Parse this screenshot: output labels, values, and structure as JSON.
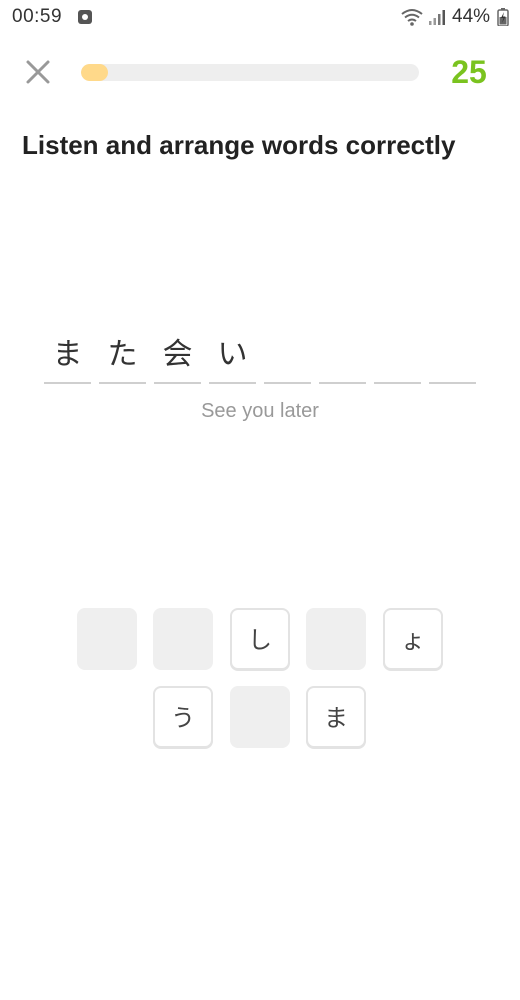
{
  "status_bar": {
    "time": "00:59",
    "battery_percent": "44%"
  },
  "header": {
    "score": "25",
    "progress": 0.08,
    "colors": {
      "progress_fill": "#ffd98a",
      "progress_track": "#eeeeee",
      "score": "#7ac31f"
    }
  },
  "exercise": {
    "instruction": "Listen and arrange words correctly",
    "translation": "See you later",
    "slots": [
      "ま",
      "た",
      "会",
      "い",
      "",
      "",
      "",
      ""
    ],
    "tiles_row1": [
      {
        "char": "",
        "state": "used"
      },
      {
        "char": "",
        "state": "used"
      },
      {
        "char": "し",
        "state": "available"
      },
      {
        "char": "",
        "state": "used"
      },
      {
        "char": "ょ",
        "state": "available"
      }
    ],
    "tiles_row2": [
      {
        "char": "う",
        "state": "available"
      },
      {
        "char": "",
        "state": "used"
      },
      {
        "char": "ま",
        "state": "available"
      }
    ]
  },
  "icons": {
    "close": "close-icon",
    "wifi": "wifi-icon",
    "signal": "signal-icon",
    "battery": "battery-charging-icon",
    "app": "app-notification-icon"
  }
}
